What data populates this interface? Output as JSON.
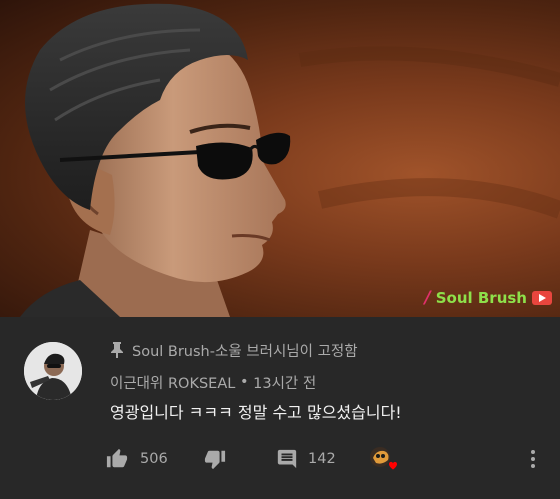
{
  "video": {
    "watermark_text": "Soul Brush",
    "watermark_colors": {
      "slash": "#e0306a",
      "text": "#8ee04a",
      "logo": "#e8463e"
    }
  },
  "comment": {
    "pinned_label": "Soul Brush-소울 브러시님이 고정함",
    "author": "이근대위 ROKSEAL",
    "time": "13시간 전",
    "text": "영광입니다 ㅋㅋㅋ 정말 수고 많으셨습니다!",
    "likes": "506",
    "replies": "142"
  },
  "icons": {
    "pin": "pin-icon",
    "like": "thumbs-up-icon",
    "dislike": "thumbs-down-icon",
    "reply": "comment-icon",
    "heart": "creator-heart-icon",
    "menu": "more-vertical-icon"
  },
  "colors": {
    "panel": "#282828",
    "secondary_text": "#aaaaaa",
    "primary_text": "#f1f1f1",
    "heart": "#ff0000"
  }
}
